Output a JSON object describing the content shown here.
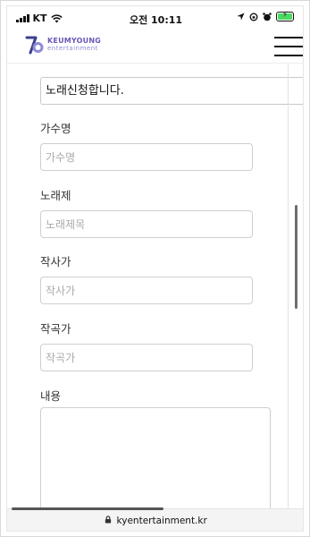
{
  "status_bar": {
    "carrier": "KT",
    "time": "오전 10:11",
    "battery_color": "#4cd964"
  },
  "header": {
    "logo_brand": "KEUMYOUNG",
    "logo_sub": "entertainment",
    "brand_color": "#6a57b8",
    "menu_icon": "hamburger-icon"
  },
  "form": {
    "title_value": "노래신청합니다.",
    "fields": [
      {
        "label": "가수명",
        "placeholder": "가수명"
      },
      {
        "label": "노래제",
        "placeholder": "노래제목"
      },
      {
        "label": "작사가",
        "placeholder": "작사가"
      },
      {
        "label": "작곡가",
        "placeholder": "작곡가"
      }
    ],
    "content_label": "내용",
    "content_value": ""
  },
  "browser": {
    "url": "kyentertainment.kr",
    "lock_icon": "lock-icon"
  }
}
